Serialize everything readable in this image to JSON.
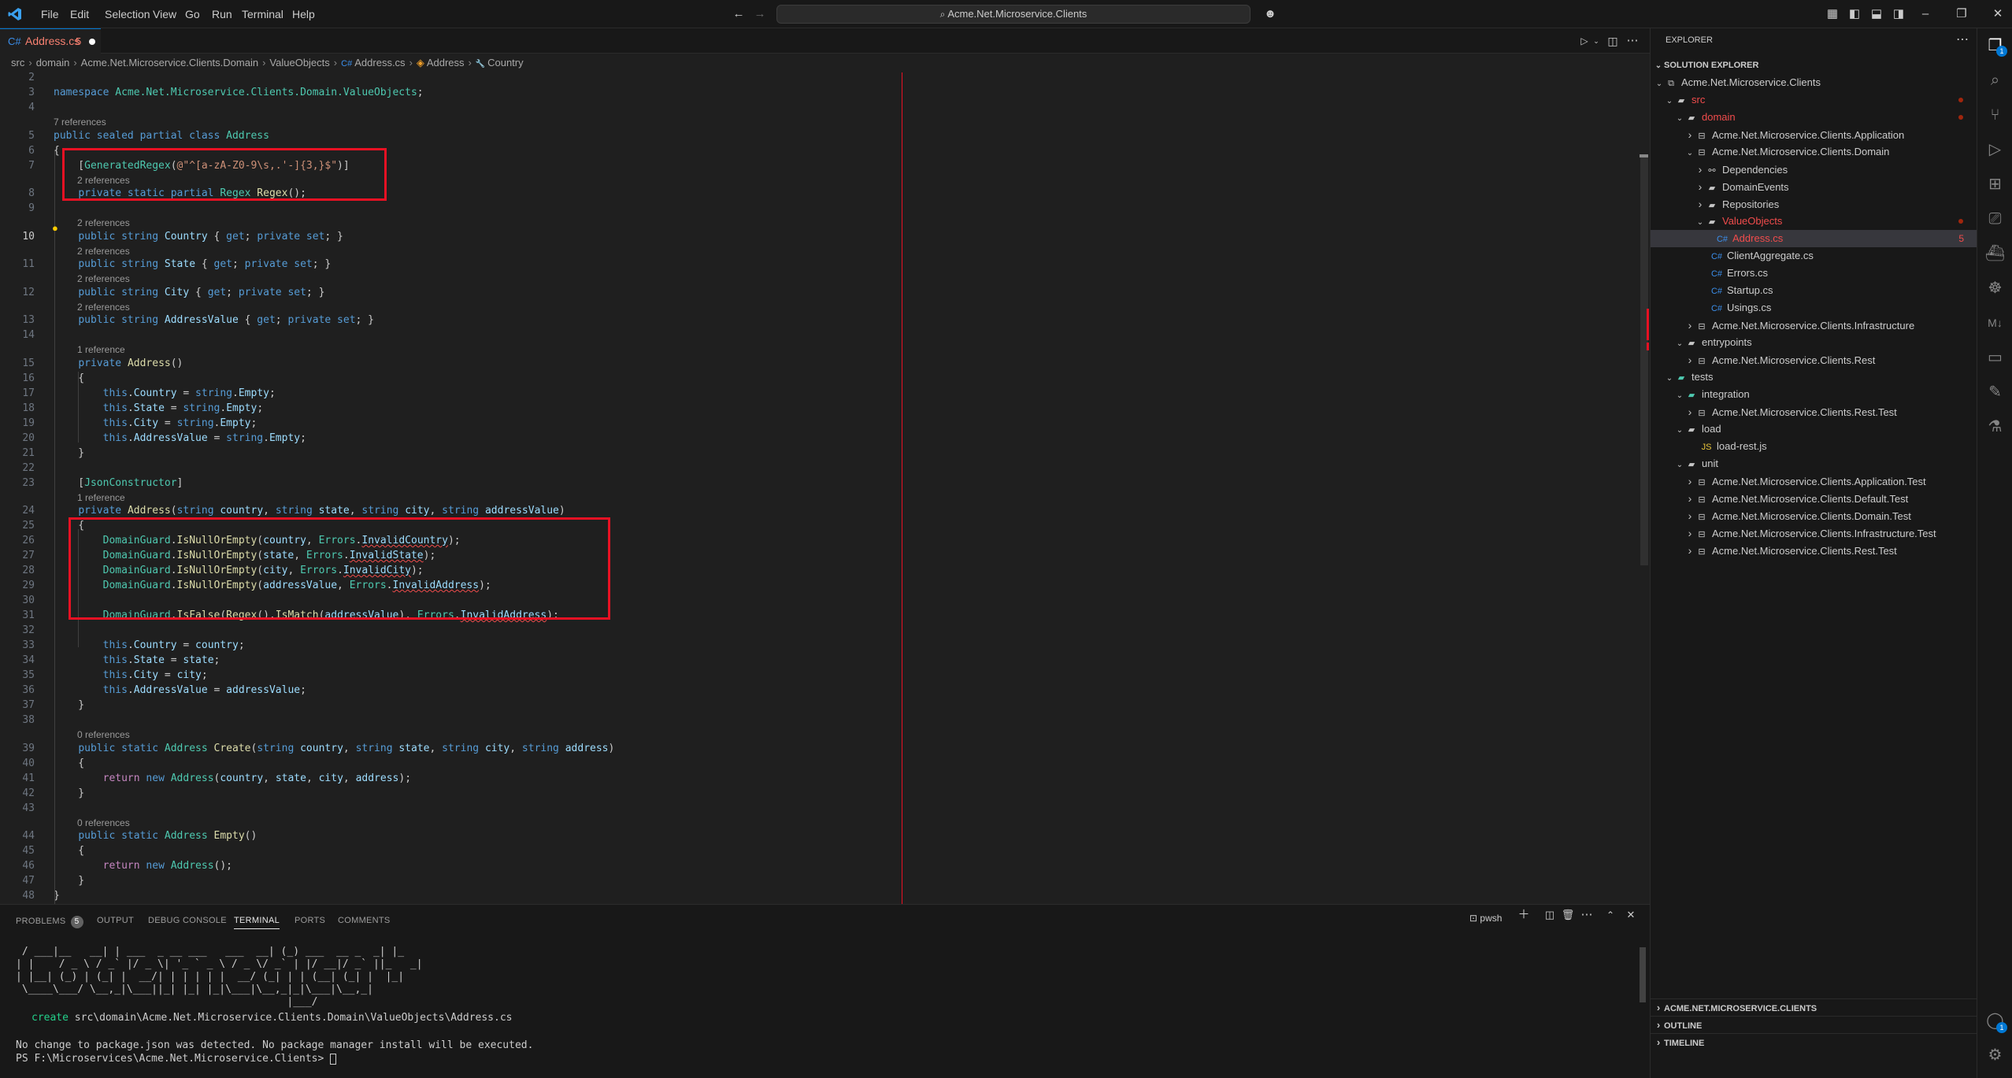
{
  "titlebar": {
    "menu": [
      "File",
      "Edit",
      "Selection",
      "View",
      "Go",
      "Run",
      "Terminal",
      "Help"
    ],
    "search": "Acme.Net.Microservice.Clients"
  },
  "tab": {
    "label": "Address.cs",
    "badge": "5"
  },
  "breadcrumb": [
    "src",
    "domain",
    "Acme.Net.Microservice.Clients.Domain",
    "ValueObjects",
    "Address.cs",
    "Address",
    "Country"
  ],
  "editor": {
    "lines": [
      {
        "n": "2",
        "html": ""
      },
      {
        "n": "3",
        "html": "<span class='kw'>namespace</span> <span class='ty'>Acme.Net.Microservice.Clients.Domain.ValueObjects</span>;"
      },
      {
        "n": "4",
        "html": ""
      },
      {
        "lens": "7 references"
      },
      {
        "n": "5",
        "html": "<span class='kw'>public sealed partial class</span> <span class='cl'>Address</span>"
      },
      {
        "n": "6",
        "html": "<span class='pu'>{</span>"
      },
      {
        "n": "7",
        "html": "    [<span class='cl'>GeneratedRegex</span>(<span class='st'>@\"^[a-zA-Z0-9\\s,.'-]{3,}$\"</span>)]"
      },
      {
        "lens": "2 references",
        "indent": 1
      },
      {
        "n": "8",
        "html": "    <span class='kw'>private static partial</span> <span class='cl'>Regex</span> <span class='fn'>Regex</span>();"
      },
      {
        "n": "9",
        "html": ""
      },
      {
        "lens": "2 references",
        "indent": 1
      },
      {
        "n": "10",
        "html": "    <span class='kw'>public string</span> <span class='pr'>Country</span> { <span class='kw'>get</span>; <span class='kw'>private set</span>; }",
        "active": true
      },
      {
        "lens": "2 references",
        "indent": 1
      },
      {
        "n": "11",
        "html": "    <span class='kw'>public string</span> <span class='pr'>State</span> { <span class='kw'>get</span>; <span class='kw'>private set</span>; }"
      },
      {
        "lens": "2 references",
        "indent": 1
      },
      {
        "n": "12",
        "html": "    <span class='kw'>public string</span> <span class='pr'>City</span> { <span class='kw'>get</span>; <span class='kw'>private set</span>; }"
      },
      {
        "lens": "2 references",
        "indent": 1
      },
      {
        "n": "13",
        "html": "    <span class='kw'>public string</span> <span class='pr'>AddressValue</span> { <span class='kw'>get</span>; <span class='kw'>private set</span>; }"
      },
      {
        "n": "14",
        "html": ""
      },
      {
        "lens": "1 reference",
        "indent": 1
      },
      {
        "n": "15",
        "html": "    <span class='kw'>private</span> <span class='fn'>Address</span>()"
      },
      {
        "n": "16",
        "html": "    {"
      },
      {
        "n": "17",
        "html": "        <span class='kw'>this</span>.<span class='pr'>Country</span> = <span class='kw'>string</span>.<span class='pr'>Empty</span>;"
      },
      {
        "n": "18",
        "html": "        <span class='kw'>this</span>.<span class='pr'>State</span> = <span class='kw'>string</span>.<span class='pr'>Empty</span>;"
      },
      {
        "n": "19",
        "html": "        <span class='kw'>this</span>.<span class='pr'>City</span> = <span class='kw'>string</span>.<span class='pr'>Empty</span>;"
      },
      {
        "n": "20",
        "html": "        <span class='kw'>this</span>.<span class='pr'>AddressValue</span> = <span class='kw'>string</span>.<span class='pr'>Empty</span>;"
      },
      {
        "n": "21",
        "html": "    }"
      },
      {
        "n": "22",
        "html": ""
      },
      {
        "n": "23",
        "html": "    [<span class='cl'>JsonConstructor</span>]"
      },
      {
        "lens": "1 reference",
        "indent": 1
      },
      {
        "n": "24",
        "html": "    <span class='kw'>private</span> <span class='fn'>Address</span>(<span class='kw'>string</span> <span class='pr'>country</span>, <span class='kw'>string</span> <span class='pr'>state</span>, <span class='kw'>string</span> <span class='pr'>city</span>, <span class='kw'>string</span> <span class='pr'>addressValue</span>)"
      },
      {
        "n": "25",
        "html": "    {"
      },
      {
        "n": "26",
        "html": "        <span class='cl'>DomainGuard</span>.<span class='fn'>IsNullOrEmpty</span>(<span class='pr'>country</span>, <span class='cl'>Errors</span>.<span class='pr squig'>InvalidCountry</span>);"
      },
      {
        "n": "27",
        "html": "        <span class='cl'>DomainGuard</span>.<span class='fn'>IsNullOrEmpty</span>(<span class='pr'>state</span>, <span class='cl'>Errors</span>.<span class='pr squig'>InvalidState</span>);"
      },
      {
        "n": "28",
        "html": "        <span class='cl'>DomainGuard</span>.<span class='fn'>IsNullOrEmpty</span>(<span class='pr'>city</span>, <span class='cl'>Errors</span>.<span class='pr squig'>InvalidCity</span>);"
      },
      {
        "n": "29",
        "html": "        <span class='cl'>DomainGuard</span>.<span class='fn'>IsNullOrEmpty</span>(<span class='pr'>addressValue</span>, <span class='cl'>Errors</span>.<span class='pr squig'>InvalidAddress</span>);"
      },
      {
        "n": "30",
        "html": ""
      },
      {
        "n": "31",
        "html": "        <span class='cl'>DomainGuard</span>.<span class='fn'>IsFalse</span>(<span class='fn'>Regex</span>().<span class='fn'>IsMatch</span>(<span class='pr'>addressValue</span>), <span class='cl'>Errors</span>.<span class='pr squig'>InvalidAddress</span>);"
      },
      {
        "n": "32",
        "html": ""
      },
      {
        "n": "33",
        "html": "        <span class='kw'>this</span>.<span class='pr'>Country</span> = <span class='pr'>country</span>;"
      },
      {
        "n": "34",
        "html": "        <span class='kw'>this</span>.<span class='pr'>State</span> = <span class='pr'>state</span>;"
      },
      {
        "n": "35",
        "html": "        <span class='kw'>this</span>.<span class='pr'>City</span> = <span class='pr'>city</span>;"
      },
      {
        "n": "36",
        "html": "        <span class='kw'>this</span>.<span class='pr'>AddressValue</span> = <span class='pr'>addressValue</span>;"
      },
      {
        "n": "37",
        "html": "    }"
      },
      {
        "n": "38",
        "html": ""
      },
      {
        "lens": "0 references",
        "indent": 1
      },
      {
        "n": "39",
        "html": "    <span class='kw'>public static</span> <span class='cl'>Address</span> <span class='fn'>Create</span>(<span class='kw'>string</span> <span class='pr'>country</span>, <span class='kw'>string</span> <span class='pr'>state</span>, <span class='kw'>string</span> <span class='pr'>city</span>, <span class='kw'>string</span> <span class='pr'>address</span>)"
      },
      {
        "n": "40",
        "html": "    {"
      },
      {
        "n": "41",
        "html": "        <span class='ctl'>return</span> <span class='kw'>new</span> <span class='cl'>Address</span>(<span class='pr'>country</span>, <span class='pr'>state</span>, <span class='pr'>city</span>, <span class='pr'>address</span>);"
      },
      {
        "n": "42",
        "html": "    }"
      },
      {
        "n": "43",
        "html": ""
      },
      {
        "lens": "0 references",
        "indent": 1
      },
      {
        "n": "44",
        "html": "    <span class='kw'>public static</span> <span class='cl'>Address</span> <span class='fn'>Empty</span>()"
      },
      {
        "n": "45",
        "html": "    {"
      },
      {
        "n": "46",
        "html": "        <span class='ctl'>return</span> <span class='kw'>new</span> <span class='cl'>Address</span>();"
      },
      {
        "n": "47",
        "html": "    }"
      },
      {
        "n": "48",
        "html": "}"
      },
      {
        "n": "49",
        "html": ""
      }
    ]
  },
  "panel": {
    "tabs": [
      "PROBLEMS",
      "OUTPUT",
      "DEBUG CONSOLE",
      "TERMINAL",
      "PORTS",
      "COMMENTS"
    ],
    "problems_count": "5",
    "active_tab": "TERMINAL",
    "shell": "pwsh",
    "ascii_art": [
      " / ___|__   __| | ___  _ __ ___   ___  __| (_) ___  __ _  _| |_",
      "| |    / _ \\ / _` |/ _ \\| '_ ` _ \\ / _ \\/ _` | |/ __|/ _` ||_   _|",
      "| |__| (_) | (_| |  __/| | | | | |  __/ (_| | | (__| (_| |  |_|",
      " \\____\\___/ \\__,_|\\___||_| |_| |_|\\___|\\__,_|_|\\___|\\__,_|",
      "                                            |___/"
    ],
    "create_keyword": "create",
    "create_path": "src\\domain\\Acme.Net.Microservice.Clients.Domain\\ValueObjects\\Address.cs",
    "msg1": "No change to package.json was detected. No package manager install will be executed.",
    "prompt": "PS F:\\Microservices\\Acme.Net.Microservice.Clients> "
  },
  "sidebar": {
    "header": "EXPLORER",
    "section": "SOLUTION EXPLORER",
    "tree": [
      {
        "label": "Acme.Net.Microservice.Clients",
        "depth": 0,
        "chev": "v",
        "icon": "solution-icon"
      },
      {
        "label": "src",
        "depth": 1,
        "chev": "v",
        "icon": "folder-icon",
        "color": "#f14c4c",
        "dot": true
      },
      {
        "label": "domain",
        "depth": 2,
        "chev": "v",
        "icon": "folder-icon",
        "color": "#f14c4c",
        "dot": true
      },
      {
        "label": "Acme.Net.Microservice.Clients.Application",
        "depth": 3,
        "chev": ">",
        "icon": "project-icon"
      },
      {
        "label": "Acme.Net.Microservice.Clients.Domain",
        "depth": 3,
        "chev": "v",
        "icon": "project-icon"
      },
      {
        "label": "Dependencies",
        "depth": 4,
        "chev": ">",
        "icon": "dependencies-icon"
      },
      {
        "label": "DomainEvents",
        "depth": 4,
        "chev": ">",
        "icon": "folder-icon"
      },
      {
        "label": "Repositories",
        "depth": 4,
        "chev": ">",
        "icon": "folder-icon"
      },
      {
        "label": "ValueObjects",
        "depth": 4,
        "chev": "v",
        "icon": "folder-icon",
        "color": "#f14c4c",
        "dot": true
      },
      {
        "label": "Address.cs",
        "depth": 5,
        "chev": "",
        "icon": "csharp-icon",
        "color": "#f14c4c",
        "badge": "5",
        "selected": true
      },
      {
        "label": "ClientAggregate.cs",
        "depth": 4,
        "chev": "",
        "icon": "csharp-icon",
        "pad": true
      },
      {
        "label": "Errors.cs",
        "depth": 4,
        "chev": "",
        "icon": "csharp-icon",
        "pad": true
      },
      {
        "label": "Startup.cs",
        "depth": 4,
        "chev": "",
        "icon": "csharp-icon",
        "pad": true
      },
      {
        "label": "Usings.cs",
        "depth": 4,
        "chev": "",
        "icon": "csharp-icon",
        "pad": true
      },
      {
        "label": "Acme.Net.Microservice.Clients.Infrastructure",
        "depth": 3,
        "chev": ">",
        "icon": "project-icon"
      },
      {
        "label": "entrypoints",
        "depth": 2,
        "chev": "v",
        "icon": "folder-icon"
      },
      {
        "label": "Acme.Net.Microservice.Clients.Rest",
        "depth": 3,
        "chev": ">",
        "icon": "project-icon"
      },
      {
        "label": "tests",
        "depth": 1,
        "chev": "v",
        "icon": "test-folder-icon"
      },
      {
        "label": "integration",
        "depth": 2,
        "chev": "v",
        "icon": "test-folder-icon"
      },
      {
        "label": "Acme.Net.Microservice.Clients.Rest.Test",
        "depth": 3,
        "chev": ">",
        "icon": "project-icon"
      },
      {
        "label": "load",
        "depth": 2,
        "chev": "v",
        "icon": "folder-icon"
      },
      {
        "label": "load-rest.js",
        "depth": 3,
        "chev": "",
        "icon": "js-icon",
        "pad": true
      },
      {
        "label": "unit",
        "depth": 2,
        "chev": "v",
        "icon": "folder-icon"
      },
      {
        "label": "Acme.Net.Microservice.Clients.Application.Test",
        "depth": 3,
        "chev": ">",
        "icon": "project-icon"
      },
      {
        "label": "Acme.Net.Microservice.Clients.Default.Test",
        "depth": 3,
        "chev": ">",
        "icon": "project-icon"
      },
      {
        "label": "Acme.Net.Microservice.Clients.Domain.Test",
        "depth": 3,
        "chev": ">",
        "icon": "project-icon"
      },
      {
        "label": "Acme.Net.Microservice.Clients.Infrastructure.Test",
        "depth": 3,
        "chev": ">",
        "icon": "project-icon"
      },
      {
        "label": "Acme.Net.Microservice.Clients.Rest.Test",
        "depth": 3,
        "chev": ">",
        "icon": "project-icon"
      }
    ],
    "bottom_sections": [
      "ACME.NET.MICROSERVICE.CLIENTS",
      "OUTLINE",
      "TIMELINE"
    ]
  },
  "activity": {
    "explorer_badge": "1",
    "accounts_badge": "1"
  },
  "colors": {
    "accent": "#0078d4",
    "error": "#f14c4c",
    "highlight_box": "#e81123"
  }
}
